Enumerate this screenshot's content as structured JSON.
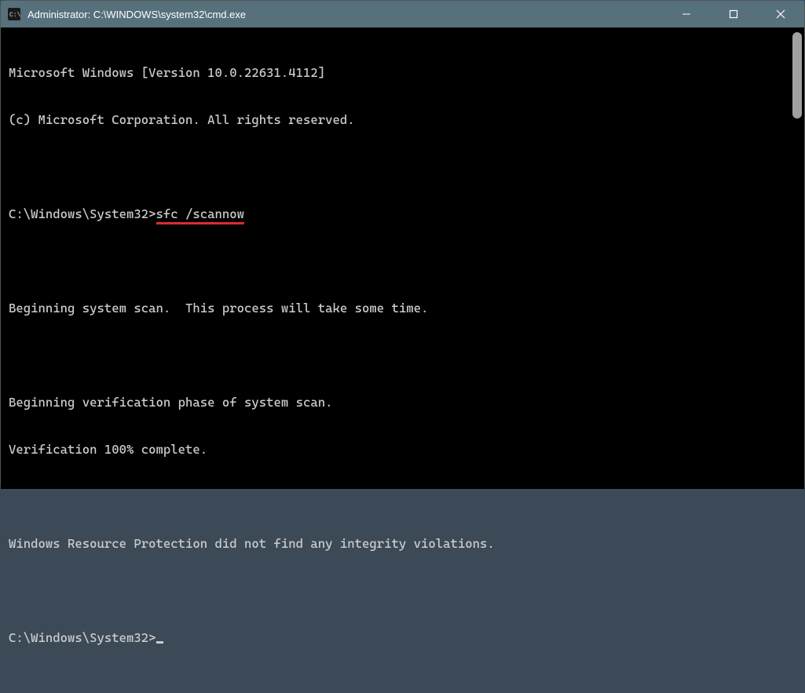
{
  "titlebar": {
    "title": "Administrator: C:\\WINDOWS\\system32\\cmd.exe"
  },
  "terminal": {
    "line_version": "Microsoft Windows [Version 10.0.22631.4112]",
    "line_copyright": "(c) Microsoft Corporation. All rights reserved.",
    "prompt1_prefix": "C:\\Windows\\System32>",
    "prompt1_command": "sfc /scannow",
    "line_begin_scan": "Beginning system scan.  This process will take some time.",
    "line_verif_phase": "Beginning verification phase of system scan.",
    "line_verif_complete": "Verification 100% complete.",
    "line_result": "Windows Resource Protection did not find any integrity violations.",
    "prompt2_prefix": "C:\\Windows\\System32>"
  }
}
